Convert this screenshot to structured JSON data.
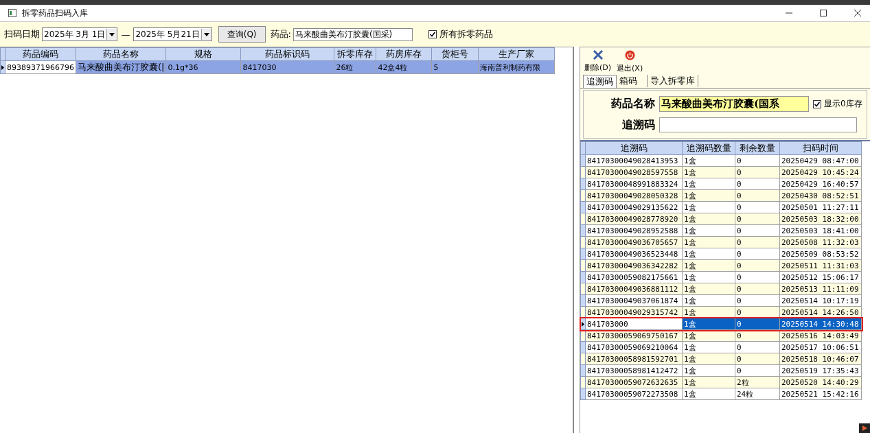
{
  "window": {
    "title": "拆零药品扫码入库"
  },
  "toolbar": {
    "date_label": "扫码日期",
    "date_from": "2025年  3月  1日",
    "separator": "—",
    "date_to": "2025年  5月21日",
    "query_button": "查询(Q)",
    "drug_label": "药品:",
    "drug_value": "马来酸曲美布汀胶囊(国采)",
    "all_checkbox": {
      "label": "所有拆零药品",
      "checked": true
    }
  },
  "drug_table": {
    "columns": [
      "药品编码",
      "药品名称",
      "规格",
      "药品标识码",
      "拆零库存",
      "药房库存",
      "货柜号",
      "生产厂家"
    ],
    "rows": [
      {
        "selected": true,
        "cells": [
          "89389371966796",
          "马来酸曲美布汀胶囊(|",
          "0.1g*36",
          "8417030",
          "26粒",
          "42盒4粒",
          "5",
          "海南普利制药有限"
        ]
      }
    ]
  },
  "side_toolbar": [
    {
      "kind": "delete",
      "label": "删除(D)"
    },
    {
      "kind": "exit",
      "label": "退出(X)"
    }
  ],
  "tabs": [
    {
      "label": "追溯码",
      "selected": true
    },
    {
      "label": "箱码",
      "selected": false
    },
    {
      "label": "导入拆零库",
      "selected": false
    }
  ],
  "form": {
    "name_label": "药品名称",
    "name_value": "马来酸曲美布汀胶囊(国系",
    "show_zero": {
      "label": "显示0库存",
      "checked": true
    },
    "code_label": "追溯码"
  },
  "trace_table": {
    "columns": [
      "追溯码",
      "追溯码数量",
      "剩余数量",
      "扫码时间"
    ],
    "rows": [
      {
        "selected": false,
        "cells": [
          "84170300049028413953",
          "1盒",
          "0",
          "20250429 08:47:00"
        ]
      },
      {
        "selected": false,
        "cells": [
          "84170300049028597558",
          "1盒",
          "0",
          "20250429 10:45:24"
        ]
      },
      {
        "selected": false,
        "cells": [
          "84170300048991883324",
          "1盒",
          "0",
          "20250429 16:40:57"
        ]
      },
      {
        "selected": false,
        "cells": [
          "84170300049028050328",
          "1盒",
          "0",
          "20250430 08:52:51"
        ]
      },
      {
        "selected": false,
        "cells": [
          "84170300049029135622",
          "1盒",
          "0",
          "20250501 11:27:11"
        ]
      },
      {
        "selected": false,
        "cells": [
          "84170300049028778920",
          "1盒",
          "0",
          "20250503 18:32:00"
        ]
      },
      {
        "selected": false,
        "cells": [
          "84170300049028952588",
          "1盒",
          "0",
          "20250503 18:41:00"
        ]
      },
      {
        "selected": false,
        "cells": [
          "84170300049036705657",
          "1盒",
          "0",
          "20250508 11:32:03"
        ]
      },
      {
        "selected": false,
        "cells": [
          "84170300049036523448",
          "1盒",
          "0",
          "20250509 08:53:52"
        ]
      },
      {
        "selected": false,
        "cells": [
          "84170300049036342282",
          "1盒",
          "0",
          "20250511 11:31:03"
        ]
      },
      {
        "selected": false,
        "cells": [
          "84170300059082175661",
          "1盒",
          "0",
          "20250512 15:06:17"
        ]
      },
      {
        "selected": false,
        "cells": [
          "84170300049036881112",
          "1盒",
          "0",
          "20250513 11:11:09"
        ]
      },
      {
        "selected": false,
        "cells": [
          "84170300049037061874",
          "1盒",
          "0",
          "20250514 10:17:19"
        ]
      },
      {
        "selected": false,
        "cells": [
          "84170300049029315742",
          "1盒",
          "0",
          "20250514 14:26:50"
        ]
      },
      {
        "selected": true,
        "cells": [
          "841703000",
          "1盒",
          "0",
          "20250514 14:30:48"
        ]
      },
      {
        "selected": false,
        "cells": [
          "84170300059069750167",
          "1盒",
          "0",
          "20250516 14:03:49"
        ]
      },
      {
        "selected": false,
        "cells": [
          "84170300059069210064",
          "1盒",
          "0",
          "20250517 10:06:51"
        ]
      },
      {
        "selected": false,
        "cells": [
          "84170300058981592701",
          "1盒",
          "0",
          "20250518 10:46:07"
        ]
      },
      {
        "selected": false,
        "cells": [
          "84170300058981412472",
          "1盒",
          "0",
          "20250519 17:35:43"
        ]
      },
      {
        "selected": false,
        "cells": [
          "84170300059072632635",
          "1盒",
          "2粒",
          "20250520 14:40:29"
        ]
      },
      {
        "selected": false,
        "cells": [
          "84170300059072273508",
          "1盒",
          "24粒",
          "20250521 15:42:16"
        ]
      }
    ]
  }
}
